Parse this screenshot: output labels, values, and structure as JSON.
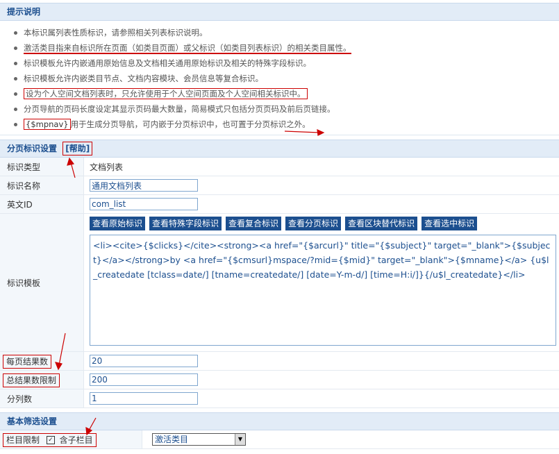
{
  "tips": {
    "title": "提示说明",
    "items": [
      "本标识属列表性质标识，请参照相关列表标识说明。",
      "激活类目指来自标识所在页面（如类目页面）或父标识（如类目列表标识）的相关类目属性。",
      "标识模板允许内嵌通用原始信息及文档相关通用原始标识及相关的特殊字段标识。",
      "标识模板允许内嵌类目节点、文档内容模块、会员信息等复合标识。",
      "设为个人空间文档列表时，只允许使用于个人空间页面及个人空间相关标识中。",
      "分页导航的页码长度设定其显示页码最大数量，简易模式只包括分页页码及前后页链接。"
    ],
    "last_tag": "{$mpnav}",
    "last_text": "用于生成分页导航，可内嵌于分页标识中，也可置于分页标识之外。"
  },
  "paging": {
    "title": "分页标识设置",
    "help": "[帮助]",
    "rows": {
      "type_label": "标识类型",
      "type_value": "文档列表",
      "name_label": "标识名称",
      "name_value": "通用文档列表",
      "ename_label": "英文ID",
      "ename_value": "com_list",
      "tpl_label": "标识模板",
      "per_label": "每页结果数",
      "per_value": "20",
      "total_label": "总结果数限制",
      "total_value": "200",
      "cols_label": "分列数",
      "cols_value": "1"
    },
    "buttons": [
      "查看原始标识",
      "查看特殊字段标识",
      "查看复合标识",
      "查看分页标识",
      "查看区块替代标识",
      "查看选中标识"
    ],
    "template": "<li><cite>{$clicks}</cite><strong><a href=\"{$arcurl}\" title=\"{$subject}\"  target=\"_blank\">{$subject}</a></strong>by <a href=\"{$cmsurl}mspace/?mid={$mid}\" target=\"_blank\">{$mname}</a> {u$l_createdate [tclass=date/] [tname=createdate/] [date=Y-m-d/] [time=H:i/]}{/u$l_createdate}</li>"
  },
  "filter": {
    "title": "基本筛选设置",
    "cat_label": "栏目限制",
    "sub_label": "含子栏目",
    "select_value": "激活类目"
  },
  "colors": {
    "accent": "#1c4f8f",
    "header_bg": "#e2ecf7",
    "annotation": "#cc0000"
  }
}
